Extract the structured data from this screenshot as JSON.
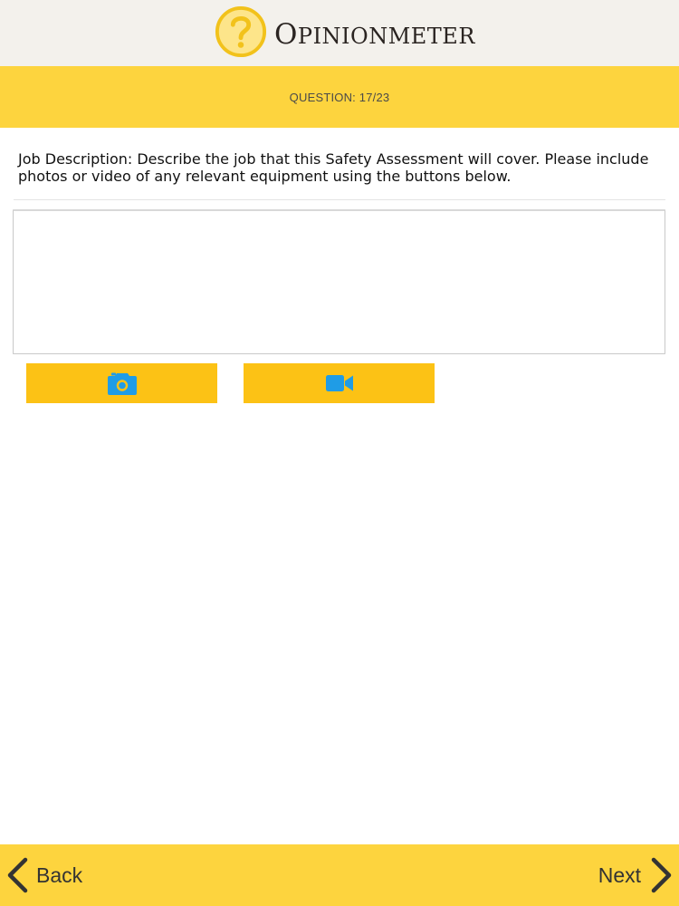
{
  "header": {
    "logo_text_initial": "O",
    "logo_text_rest": "PINIONMETER"
  },
  "question": {
    "counter": "QUESTION: 17/23",
    "text": "Job Description: Describe the job that this Safety Assessment will cover. Please include photos or video of any relevant equipment using the buttons below."
  },
  "answer": {
    "value": "",
    "placeholder": ""
  },
  "media_buttons": {
    "photo_icon": "camera-icon",
    "video_icon": "video-camera-icon"
  },
  "nav": {
    "back_label": "Back",
    "next_label": "Next"
  },
  "colors": {
    "header_bg": "#f3f1ec",
    "band_yellow": "#fdd43e",
    "button_yellow": "#fcc215",
    "icon_blue": "#1f9ce6",
    "logo_gold": "#f2c21b"
  }
}
